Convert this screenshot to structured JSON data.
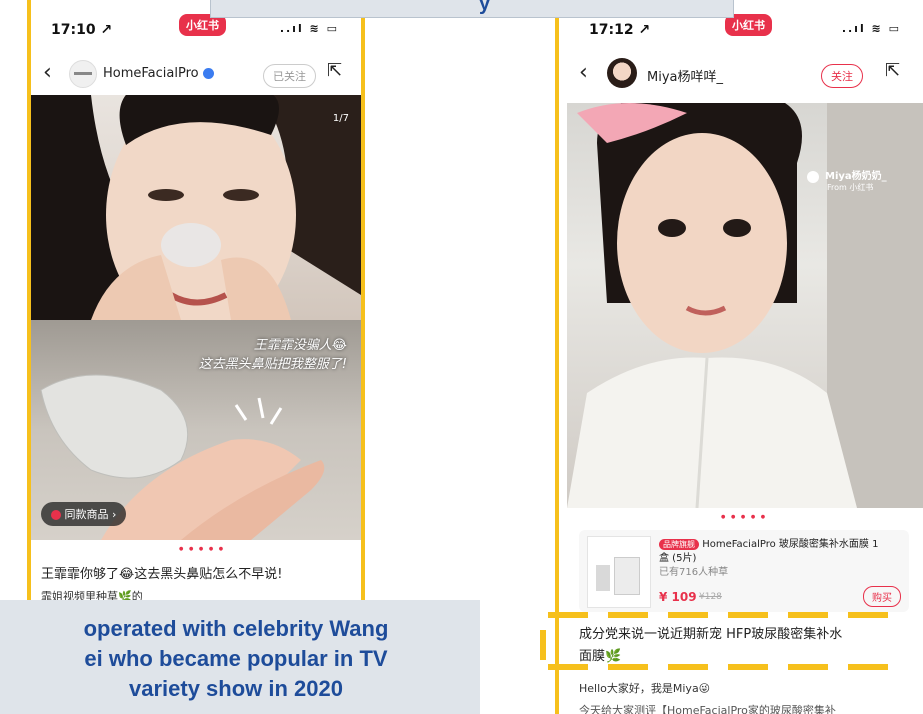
{
  "left_phone": {
    "status": {
      "time": "17:10 ↗",
      "app_logo": "小红书",
      "icons": "..ıl ≋ ▭"
    },
    "nav": {
      "back": "‹",
      "account_name": "HomeFacialPro",
      "follow_label": "已关注",
      "share": "⇱"
    },
    "photo_counter": "1/7",
    "caption_line1": "王霏霏没骗人😂",
    "caption_line2": "这去黑头鼻贴把我整服了!",
    "same_item_label": "同款商品",
    "same_item_arrow": "›",
    "dots": "● ● ● ● ●",
    "post_title": "王霏霏你够了😂这去黑头鼻贴怎么不早说!",
    "post_sub": "霏姐视频里种草🌿的"
  },
  "right_phone": {
    "status": {
      "time": "17:12 ↗",
      "app_logo": "小红书",
      "icons": "..ıl ≋ ▭"
    },
    "nav": {
      "back": "‹",
      "account_name": "Miya杨咩咩_",
      "follow_label": "关注",
      "share": "⇱"
    },
    "watermark_name": "Miya杨奶奶_",
    "watermark_from": "From 小红书",
    "dots": "● ● ● ● ●",
    "product": {
      "badge": "品牌旗舰",
      "title_line1": "HomeFacialPro 玻尿酸密集补水面膜 1",
      "title_line2": "盒 (5片)",
      "planted": "已有716人种草",
      "price": "¥ 109",
      "old_price": "¥128",
      "buy_label": "购买"
    },
    "post_title_line1": "成分党来说一说近期新宠 HFP玻尿酸密集补水",
    "post_title_line2": "面膜🌿",
    "post_body": "Hello大家好，我是Miya😜",
    "post_body2": "今天给大家测评【HomeFacialPro家的玻尿酸密集补"
  },
  "top_banner": {
    "text": "y"
  },
  "bottom_banner": {
    "line1": "operated with celebrity Wang",
    "line2": "ei who became popular in TV",
    "line3": "variety show in 2020"
  },
  "colors": {
    "accent_yellow": "#f6c01c",
    "brand_red": "#e8314b",
    "banner_text": "#1e4c9a",
    "banner_bg": "#dfe4ea"
  }
}
